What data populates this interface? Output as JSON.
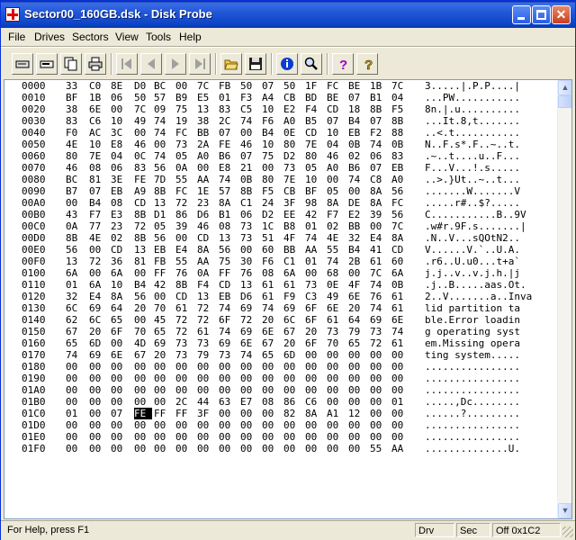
{
  "window": {
    "title": "Sector00_160GB.dsk - Disk Probe"
  },
  "menu": [
    "File",
    "Drives",
    "Sectors",
    "View",
    "Tools",
    "Help"
  ],
  "toolbar": {
    "buttons": [
      "read-sector-icon",
      "read-drive-icon",
      "copy-icon",
      "print-icon",
      "first-sector-icon",
      "prev-sector-icon",
      "next-sector-icon",
      "last-sector-icon",
      "open-icon",
      "save-icon",
      "info-icon",
      "search-icon",
      "help-icon",
      "context-help-icon"
    ]
  },
  "hex": {
    "selected": {
      "row": 28,
      "col": 3
    },
    "rows": [
      {
        "addr": "0000",
        "bytes": [
          "33",
          "C0",
          "8E",
          "D0",
          "BC",
          "00",
          "7C",
          "FB",
          "50",
          "07",
          "50",
          "1F",
          "FC",
          "BE",
          "1B",
          "7C"
        ],
        "ascii": "3.....|.P.P....|"
      },
      {
        "addr": "0010",
        "bytes": [
          "BF",
          "1B",
          "06",
          "50",
          "57",
          "B9",
          "E5",
          "01",
          "F3",
          "A4",
          "CB",
          "BD",
          "BE",
          "07",
          "B1",
          "04"
        ],
        "ascii": "...PW..........."
      },
      {
        "addr": "0020",
        "bytes": [
          "38",
          "6E",
          "00",
          "7C",
          "09",
          "75",
          "13",
          "83",
          "C5",
          "10",
          "E2",
          "F4",
          "CD",
          "18",
          "8B",
          "F5"
        ],
        "ascii": "8n.|.u.........."
      },
      {
        "addr": "0030",
        "bytes": [
          "83",
          "C6",
          "10",
          "49",
          "74",
          "19",
          "38",
          "2C",
          "74",
          "F6",
          "A0",
          "B5",
          "07",
          "B4",
          "07",
          "8B"
        ],
        "ascii": "...It.8,t......."
      },
      {
        "addr": "0040",
        "bytes": [
          "F0",
          "AC",
          "3C",
          "00",
          "74",
          "FC",
          "BB",
          "07",
          "00",
          "B4",
          "0E",
          "CD",
          "10",
          "EB",
          "F2",
          "88"
        ],
        "ascii": "..<.t..........."
      },
      {
        "addr": "0050",
        "bytes": [
          "4E",
          "10",
          "E8",
          "46",
          "00",
          "73",
          "2A",
          "FE",
          "46",
          "10",
          "80",
          "7E",
          "04",
          "0B",
          "74",
          "0B"
        ],
        "ascii": "N..F.s*.F..~..t."
      },
      {
        "addr": "0060",
        "bytes": [
          "80",
          "7E",
          "04",
          "0C",
          "74",
          "05",
          "A0",
          "B6",
          "07",
          "75",
          "D2",
          "80",
          "46",
          "02",
          "06",
          "83"
        ],
        "ascii": ".~..t....u..F..."
      },
      {
        "addr": "0070",
        "bytes": [
          "46",
          "08",
          "06",
          "83",
          "56",
          "0A",
          "00",
          "E8",
          "21",
          "00",
          "73",
          "05",
          "A0",
          "B6",
          "07",
          "EB"
        ],
        "ascii": "F...V...!.s....."
      },
      {
        "addr": "0080",
        "bytes": [
          "BC",
          "81",
          "3E",
          "FE",
          "7D",
          "55",
          "AA",
          "74",
          "0B",
          "80",
          "7E",
          "10",
          "00",
          "74",
          "C8",
          "A0"
        ],
        "ascii": "..>.}Ut..~..t..."
      },
      {
        "addr": "0090",
        "bytes": [
          "B7",
          "07",
          "EB",
          "A9",
          "8B",
          "FC",
          "1E",
          "57",
          "8B",
          "F5",
          "CB",
          "BF",
          "05",
          "00",
          "8A",
          "56"
        ],
        "ascii": ".......W.......V"
      },
      {
        "addr": "00A0",
        "bytes": [
          "00",
          "B4",
          "08",
          "CD",
          "13",
          "72",
          "23",
          "8A",
          "C1",
          "24",
          "3F",
          "98",
          "8A",
          "DE",
          "8A",
          "FC"
        ],
        "ascii": ".....r#..$?....."
      },
      {
        "addr": "00B0",
        "bytes": [
          "43",
          "F7",
          "E3",
          "8B",
          "D1",
          "86",
          "D6",
          "B1",
          "06",
          "D2",
          "EE",
          "42",
          "F7",
          "E2",
          "39",
          "56"
        ],
        "ascii": "C...........B..9V"
      },
      {
        "addr": "00C0",
        "bytes": [
          "0A",
          "77",
          "23",
          "72",
          "05",
          "39",
          "46",
          "08",
          "73",
          "1C",
          "B8",
          "01",
          "02",
          "BB",
          "00",
          "7C"
        ],
        "ascii": ".w#r.9F.s.......|"
      },
      {
        "addr": "00D0",
        "bytes": [
          "8B",
          "4E",
          "02",
          "8B",
          "56",
          "00",
          "CD",
          "13",
          "73",
          "51",
          "4F",
          "74",
          "4E",
          "32",
          "E4",
          "8A"
        ],
        "ascii": ".N..V...sQOtN2.."
      },
      {
        "addr": "00E0",
        "bytes": [
          "56",
          "00",
          "CD",
          "13",
          "EB",
          "E4",
          "8A",
          "56",
          "00",
          "60",
          "BB",
          "AA",
          "55",
          "B4",
          "41",
          "CD"
        ],
        "ascii": "V......V.`..U.A."
      },
      {
        "addr": "00F0",
        "bytes": [
          "13",
          "72",
          "36",
          "81",
          "FB",
          "55",
          "AA",
          "75",
          "30",
          "F6",
          "C1",
          "01",
          "74",
          "2B",
          "61",
          "60"
        ],
        "ascii": ".r6..U.u0...t+a`"
      },
      {
        "addr": "0100",
        "bytes": [
          "6A",
          "00",
          "6A",
          "00",
          "FF",
          "76",
          "0A",
          "FF",
          "76",
          "08",
          "6A",
          "00",
          "68",
          "00",
          "7C",
          "6A"
        ],
        "ascii": "j.j..v..v.j.h.|j"
      },
      {
        "addr": "0110",
        "bytes": [
          "01",
          "6A",
          "10",
          "B4",
          "42",
          "8B",
          "F4",
          "CD",
          "13",
          "61",
          "61",
          "73",
          "0E",
          "4F",
          "74",
          "0B"
        ],
        "ascii": ".j..B.....aas.Ot."
      },
      {
        "addr": "0120",
        "bytes": [
          "32",
          "E4",
          "8A",
          "56",
          "00",
          "CD",
          "13",
          "EB",
          "D6",
          "61",
          "F9",
          "C3",
          "49",
          "6E",
          "76",
          "61"
        ],
        "ascii": "2..V.......a..Inva"
      },
      {
        "addr": "0130",
        "bytes": [
          "6C",
          "69",
          "64",
          "20",
          "70",
          "61",
          "72",
          "74",
          "69",
          "74",
          "69",
          "6F",
          "6E",
          "20",
          "74",
          "61"
        ],
        "ascii": "lid partition ta"
      },
      {
        "addr": "0140",
        "bytes": [
          "62",
          "6C",
          "65",
          "00",
          "45",
          "72",
          "72",
          "6F",
          "72",
          "20",
          "6C",
          "6F",
          "61",
          "64",
          "69",
          "6E"
        ],
        "ascii": "ble.Error loadin"
      },
      {
        "addr": "0150",
        "bytes": [
          "67",
          "20",
          "6F",
          "70",
          "65",
          "72",
          "61",
          "74",
          "69",
          "6E",
          "67",
          "20",
          "73",
          "79",
          "73",
          "74"
        ],
        "ascii": "g operating syst"
      },
      {
        "addr": "0160",
        "bytes": [
          "65",
          "6D",
          "00",
          "4D",
          "69",
          "73",
          "73",
          "69",
          "6E",
          "67",
          "20",
          "6F",
          "70",
          "65",
          "72",
          "61"
        ],
        "ascii": "em.Missing opera"
      },
      {
        "addr": "0170",
        "bytes": [
          "74",
          "69",
          "6E",
          "67",
          "20",
          "73",
          "79",
          "73",
          "74",
          "65",
          "6D",
          "00",
          "00",
          "00",
          "00",
          "00"
        ],
        "ascii": "ting system....."
      },
      {
        "addr": "0180",
        "bytes": [
          "00",
          "00",
          "00",
          "00",
          "00",
          "00",
          "00",
          "00",
          "00",
          "00",
          "00",
          "00",
          "00",
          "00",
          "00",
          "00"
        ],
        "ascii": "................"
      },
      {
        "addr": "0190",
        "bytes": [
          "00",
          "00",
          "00",
          "00",
          "00",
          "00",
          "00",
          "00",
          "00",
          "00",
          "00",
          "00",
          "00",
          "00",
          "00",
          "00"
        ],
        "ascii": "................"
      },
      {
        "addr": "01A0",
        "bytes": [
          "00",
          "00",
          "00",
          "00",
          "00",
          "00",
          "00",
          "00",
          "00",
          "00",
          "00",
          "00",
          "00",
          "00",
          "00",
          "00"
        ],
        "ascii": "................"
      },
      {
        "addr": "01B0",
        "bytes": [
          "00",
          "00",
          "00",
          "00",
          "00",
          "2C",
          "44",
          "63",
          "E7",
          "08",
          "86",
          "C6",
          "00",
          "00",
          "00",
          "01"
        ],
        "ascii": ".....,Dc........"
      },
      {
        "addr": "01C0",
        "bytes": [
          "01",
          "00",
          "07",
          "FE",
          "FF",
          "FF",
          "3F",
          "00",
          "00",
          "00",
          "82",
          "8A",
          "A1",
          "12",
          "00",
          "00"
        ],
        "ascii": "......?........."
      },
      {
        "addr": "01D0",
        "bytes": [
          "00",
          "00",
          "00",
          "00",
          "00",
          "00",
          "00",
          "00",
          "00",
          "00",
          "00",
          "00",
          "00",
          "00",
          "00",
          "00"
        ],
        "ascii": "................"
      },
      {
        "addr": "01E0",
        "bytes": [
          "00",
          "00",
          "00",
          "00",
          "00",
          "00",
          "00",
          "00",
          "00",
          "00",
          "00",
          "00",
          "00",
          "00",
          "00",
          "00"
        ],
        "ascii": "................"
      },
      {
        "addr": "01F0",
        "bytes": [
          "00",
          "00",
          "00",
          "00",
          "00",
          "00",
          "00",
          "00",
          "00",
          "00",
          "00",
          "00",
          "00",
          "00",
          "55",
          "AA"
        ],
        "ascii": "..............U."
      }
    ]
  },
  "status": {
    "message": "For Help, press F1",
    "drive": "Drv",
    "sector": "Sec",
    "offset": "Off 0x1C2"
  }
}
